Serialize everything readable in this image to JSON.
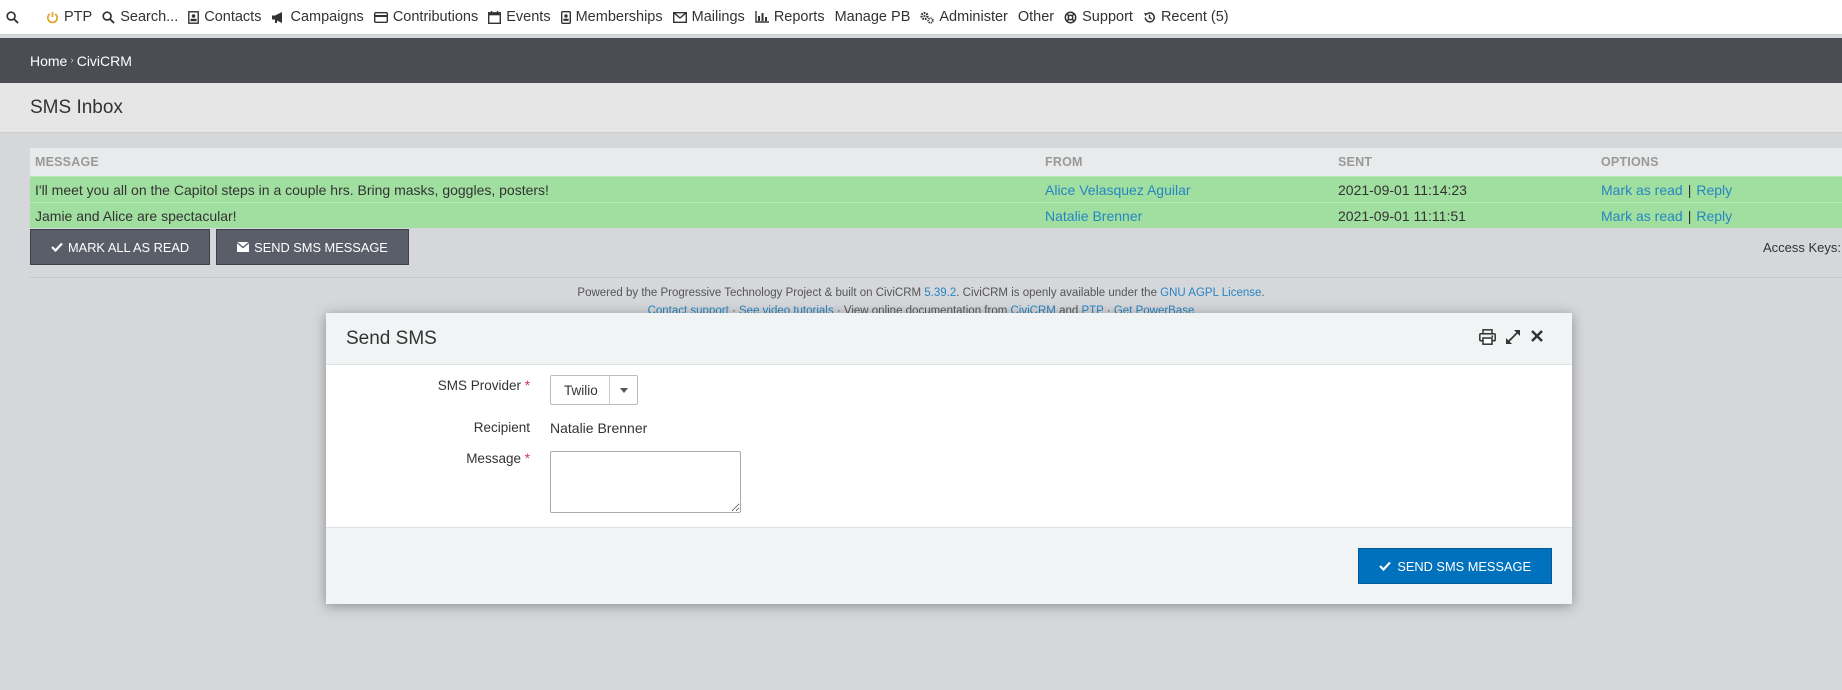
{
  "menu": {
    "items": [
      {
        "label": "PTP",
        "icon": "power-icon"
      },
      {
        "label": "Search...",
        "icon": "search-icon"
      },
      {
        "label": "Contacts",
        "icon": "contact-card-icon"
      },
      {
        "label": "Campaigns",
        "icon": "bullhorn-icon"
      },
      {
        "label": "Contributions",
        "icon": "credit-card-icon"
      },
      {
        "label": "Events",
        "icon": "calendar-icon"
      },
      {
        "label": "Memberships",
        "icon": "id-badge-icon"
      },
      {
        "label": "Mailings",
        "icon": "envelope-icon"
      },
      {
        "label": "Reports",
        "icon": "bar-chart-icon"
      },
      {
        "label": "Manage PB",
        "icon": ""
      },
      {
        "label": "Administer",
        "icon": "gears-icon"
      },
      {
        "label": "Other",
        "icon": ""
      },
      {
        "label": "Support",
        "icon": "life-ring-icon"
      },
      {
        "label": "Recent (5)",
        "icon": "history-icon"
      }
    ]
  },
  "breadcrumb": {
    "home": "Home",
    "separator": "›",
    "current": "CiviCRM"
  },
  "page": {
    "title": "SMS Inbox"
  },
  "table": {
    "headers": {
      "message": "MESSAGE",
      "from": "FROM",
      "sent": "SENT",
      "options": "OPTIONS"
    },
    "rows": [
      {
        "message": "I'll meet you all on the Capitol steps in a couple hrs. Bring masks, goggles, posters!",
        "from": "Alice Velasquez Aguilar",
        "sent": "2021-09-01 11:14:23",
        "mark": "Mark as read",
        "reply": "Reply"
      },
      {
        "message": "Jamie and Alice are spectacular!",
        "from": "Natalie Brenner",
        "sent": "2021-09-01 11:11:51",
        "mark": "Mark as read",
        "reply": "Reply"
      }
    ],
    "pipe": "|"
  },
  "actions": {
    "mark_all": "MARK ALL AS READ",
    "send_sms": "SEND SMS MESSAGE",
    "access_keys": "Access Keys:"
  },
  "footer": {
    "part1": "Powered by the Progressive Technology Project & built on CiviCRM ",
    "version": "5.39.2",
    "part2": ". CiviCRM is openly available under the ",
    "license": "GNU AGPL License",
    "part3": ".",
    "line2_support": "Contact support",
    "line2_videos": "See video tutorials",
    "line2_docs": "View online documentation from",
    "line2_civicrm": "CiviCRM",
    "line2_and": "and",
    "line2_ptp": "PTP",
    "line2_powerbase": "Get PowerBase"
  },
  "dialog": {
    "title": "Send SMS",
    "provider_label": "SMS Provider",
    "provider_value": "Twilio",
    "recipient_label": "Recipient",
    "recipient_value": "Natalie Brenner",
    "message_label": "Message",
    "required_mark": "*",
    "message_value": "",
    "send_button": "SEND SMS MESSAGE"
  },
  "colors": {
    "accent": "#0071bd",
    "row_highlight": "#a0dfa0",
    "link": "#2786c2",
    "required": "#cf3458"
  }
}
